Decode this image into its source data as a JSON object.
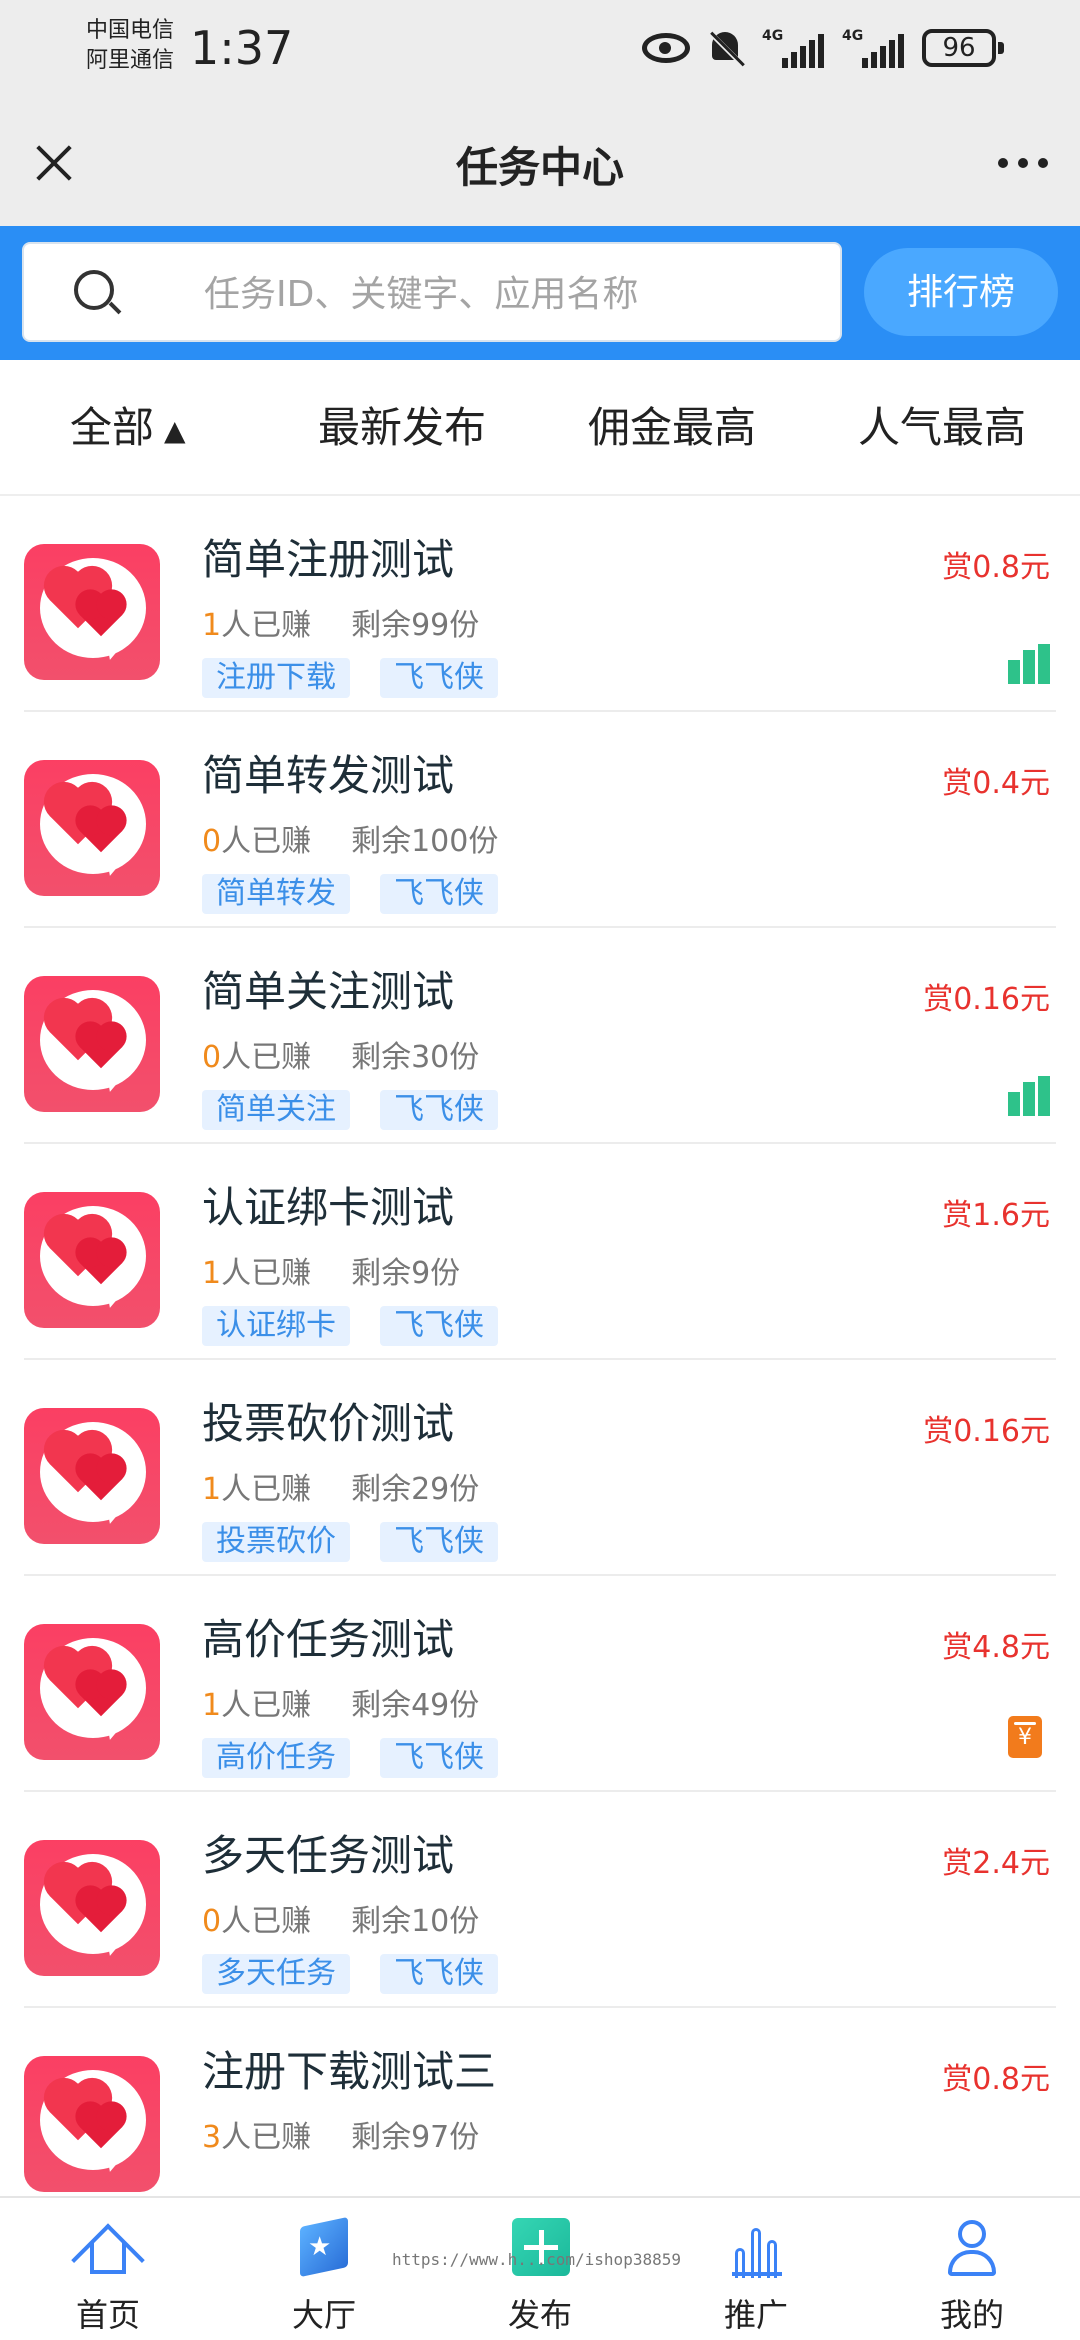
{
  "status_bar": {
    "carrier1": "中国电信",
    "carrier2": "阿里通信",
    "time": "1:37",
    "net1": "4G",
    "net2": "4G",
    "battery": "96"
  },
  "header": {
    "title": "任务中心"
  },
  "search": {
    "placeholder": "任务ID、关键字、应用名称",
    "rank_label": "排行榜"
  },
  "tabs": [
    {
      "label": "全部",
      "arrow": "▲"
    },
    {
      "label": "最新发布"
    },
    {
      "label": "佣金最高"
    },
    {
      "label": "人气最高"
    }
  ],
  "tasks": [
    {
      "title": "简单注册测试",
      "earned_num": "1",
      "earned_suffix": "人已赚",
      "remaining": "剩余99份",
      "tag1": "注册下载",
      "tag2": "飞飞侠",
      "reward": "赏0.8元",
      "badge": "bar-chart-icon"
    },
    {
      "title": "简单转发测试",
      "earned_num": "0",
      "earned_suffix": "人已赚",
      "remaining": "剩余100份",
      "tag1": "简单转发",
      "tag2": "飞飞侠",
      "reward": "赏0.4元",
      "badge": ""
    },
    {
      "title": "简单关注测试",
      "earned_num": "0",
      "earned_suffix": "人已赚",
      "remaining": "剩余30份",
      "tag1": "简单关注",
      "tag2": "飞飞侠",
      "reward": "赏0.16元",
      "badge": "bar-chart-icon"
    },
    {
      "title": "认证绑卡测试",
      "earned_num": "1",
      "earned_suffix": "人已赚",
      "remaining": "剩余9份",
      "tag1": "认证绑卡",
      "tag2": "飞飞侠",
      "reward": "赏1.6元",
      "badge": ""
    },
    {
      "title": "投票砍价测试",
      "earned_num": "1",
      "earned_suffix": "人已赚",
      "remaining": "剩余29份",
      "tag1": "投票砍价",
      "tag2": "飞飞侠",
      "reward": "赏0.16元",
      "badge": ""
    },
    {
      "title": "高价任务测试",
      "earned_num": "1",
      "earned_suffix": "人已赚",
      "remaining": "剩余49份",
      "tag1": "高价任务",
      "tag2": "飞飞侠",
      "reward": "赏4.8元",
      "badge": "money-icon"
    },
    {
      "title": "多天任务测试",
      "earned_num": "0",
      "earned_suffix": "人已赚",
      "remaining": "剩余10份",
      "tag1": "多天任务",
      "tag2": "飞飞侠",
      "reward": "赏2.4元",
      "badge": ""
    },
    {
      "title": "注册下载测试三",
      "earned_num": "3",
      "earned_suffix": "人已赚",
      "remaining": "剩余97份",
      "tag1": "",
      "tag2": "",
      "reward": "赏0.8元",
      "badge": ""
    }
  ],
  "money_glyph": "¥",
  "bottom_nav": [
    {
      "label": "首页",
      "icon": "home-icon"
    },
    {
      "label": "大厅",
      "icon": "hall-icon"
    },
    {
      "label": "发布",
      "icon": "publish-icon"
    },
    {
      "label": "推广",
      "icon": "promo-icon"
    },
    {
      "label": "我的",
      "icon": "me-icon"
    }
  ],
  "watermark_url": "https://www.h...com/ishop38859",
  "colors": {
    "primary_blue": "#2a8ef5",
    "reward_red": "#e8322e",
    "earned_orange": "#f08a1c",
    "tag_blue": "#3b8fe8",
    "badge_green": "#2ec28a"
  }
}
